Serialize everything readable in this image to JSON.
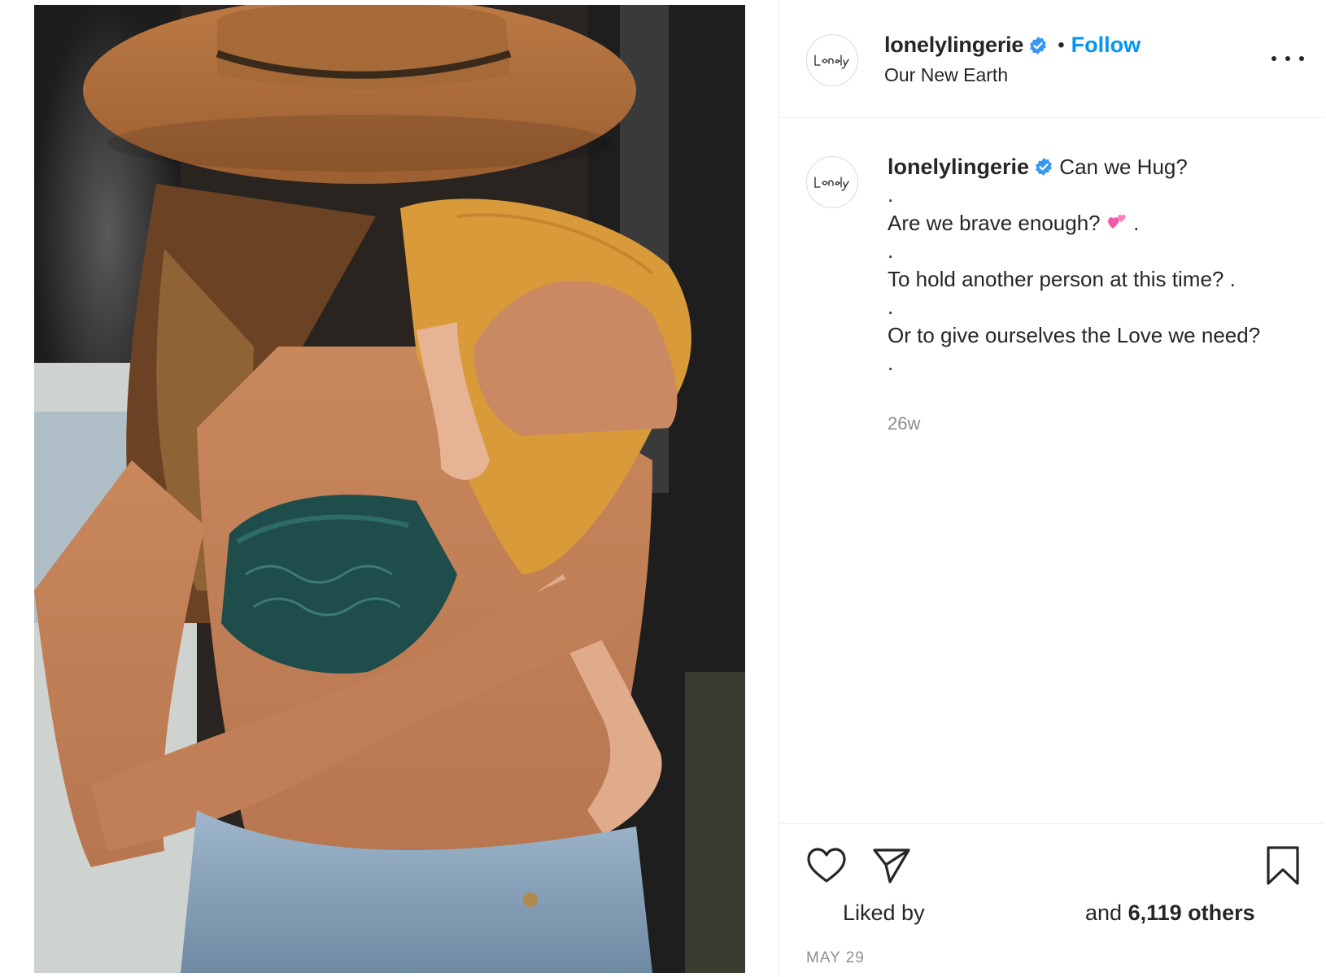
{
  "post": {
    "image_alt": "",
    "author": {
      "username": "lonelylingerie",
      "verified": true,
      "avatar_text": "Lonely"
    },
    "header": {
      "separator": "•",
      "follow_label": "Follow",
      "location": "Our New Earth",
      "more_icon": "more-options-icon"
    },
    "caption": {
      "lines": [
        "Can we Hug?",
        ".",
        "Are we brave enough?",
        ".",
        "To hold another person at this time? .",
        ".",
        "Or to give ourselves the Love we need?",
        "."
      ],
      "emoji": "two-hearts",
      "after_emoji": " .",
      "time_ago": "26w"
    },
    "actions": {
      "like_icon": "heart-icon",
      "share_icon": "paper-plane-icon",
      "save_icon": "bookmark-icon",
      "liked_by_label": "Liked by",
      "and_label": "and",
      "others_count": "6,119 others"
    },
    "date": "MAY 29"
  }
}
